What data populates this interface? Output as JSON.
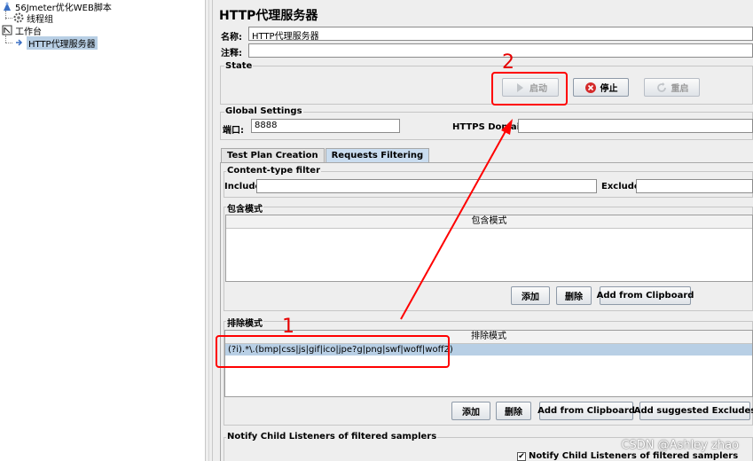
{
  "tree": {
    "items": [
      {
        "label": "56Jmeter优化WEB脚本",
        "icon": "testplan-icon"
      },
      {
        "label": "线程组",
        "icon": "gear-icon"
      },
      {
        "label": "工作台",
        "icon": "workbench-icon"
      },
      {
        "label": "HTTP代理服务器",
        "icon": "proxy-icon"
      }
    ]
  },
  "panel": {
    "title": "HTTP代理服务器",
    "name_label": "名称:",
    "name_value": "HTTP代理服务器",
    "comment_label": "注释:",
    "comment_value": ""
  },
  "state": {
    "title": "State",
    "start_label": "启动",
    "stop_label": "停止",
    "restart_label": "重启"
  },
  "global": {
    "title": "Global Settings",
    "port_label": "端口:",
    "port_value": "8888",
    "https_label": "HTTPS Domains:",
    "https_value": ""
  },
  "tabs": [
    {
      "label": "Test Plan Creation",
      "active": false
    },
    {
      "label": "Requests Filtering",
      "active": true
    }
  ],
  "content_filter": {
    "title": "Content-type filter",
    "include_label": "Include:",
    "include_value": "",
    "exclude_label": "Exclude:",
    "exclude_value": ""
  },
  "include_patterns": {
    "title": "包含模式",
    "column": "包含模式",
    "rows": [],
    "add_label": "添加",
    "delete_label": "删除",
    "clipboard_label": "Add from Clipboard"
  },
  "exclude_patterns": {
    "title": "排除模式",
    "column": "排除模式",
    "rows": [
      "(?i).*\\.(bmp|css|js|gif|ico|jpe?g|png|swf|woff|woff2)"
    ],
    "add_label": "添加",
    "delete_label": "删除",
    "clipboard_label": "Add from Clipboard",
    "suggested_label": "Add suggested Excludes"
  },
  "notify": {
    "title": "Notify Child Listeners of filtered samplers",
    "checkbox_label": "Notify Child Listeners of filtered samplers",
    "checked": true
  },
  "annotations": {
    "one": "1",
    "two": "2",
    "color": "#ff0000"
  },
  "watermark": "CSDN @Ashley zhao"
}
